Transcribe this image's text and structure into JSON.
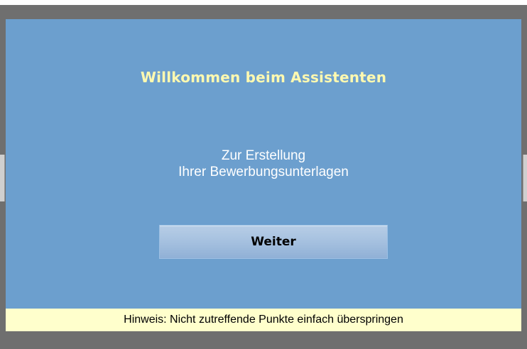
{
  "dialog": {
    "title": "Willkommen beim Assistenten",
    "subtitle_line1": "Zur Erstellung",
    "subtitle_line2": "Ihrer Bewerbungsunterlagen",
    "next_button_label": "Weiter",
    "hint": "Hinweis: Nicht zutreffende Punkte einfach überspringen"
  },
  "colors": {
    "dialog_background": "#6c9fce",
    "title_text": "#fff9b0",
    "hint_background": "#ffffcc",
    "backdrop": "#6f6f6f"
  }
}
